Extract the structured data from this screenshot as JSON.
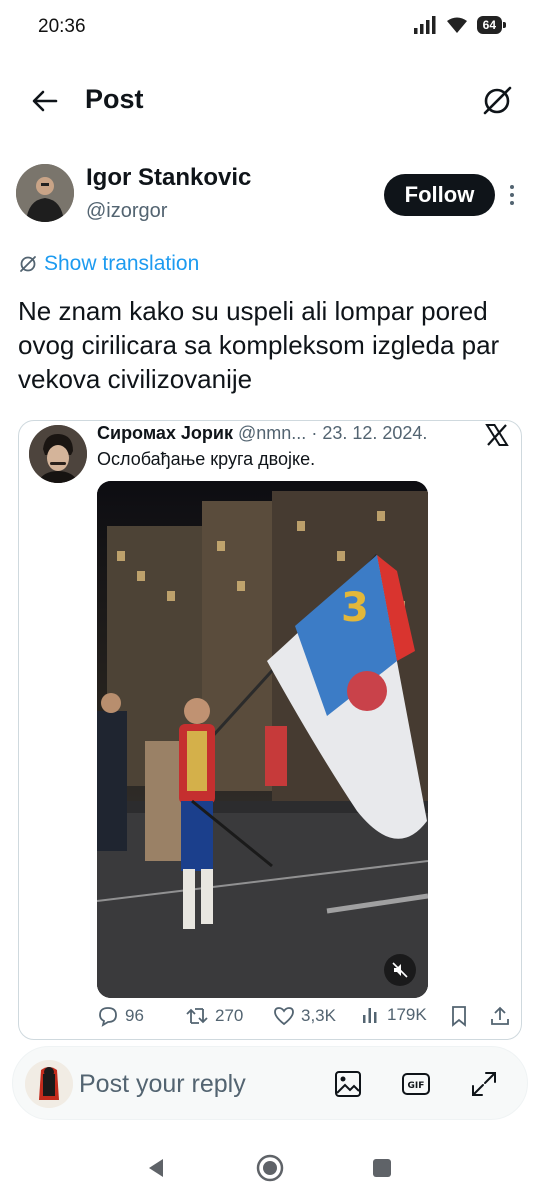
{
  "status_bar": {
    "time": "20:36",
    "battery": "64"
  },
  "header": {
    "title": "Post"
  },
  "post": {
    "author_name": "Igor Stankovic",
    "author_handle": "@izorgor",
    "follow_label": "Follow",
    "translate_label": "Show translation",
    "text": "Ne znam kako su uspeli ali lompar pored ovog cirilicara sa kompleksom izgleda par vekova civilizovanije"
  },
  "quote": {
    "name": "Сиромах Јорик",
    "handle": "@nmn...",
    "date": "· 23. 12. 2024.",
    "text": "Ослобађање круга двојке."
  },
  "actions": {
    "replies": "96",
    "reposts": "270",
    "likes": "3,3K",
    "views": "179K"
  },
  "reply": {
    "placeholder": "Post your reply"
  },
  "colors": {
    "link": "#1d9bf0",
    "text": "#0f1419",
    "muted": "#536471",
    "border": "#cfd9de"
  }
}
